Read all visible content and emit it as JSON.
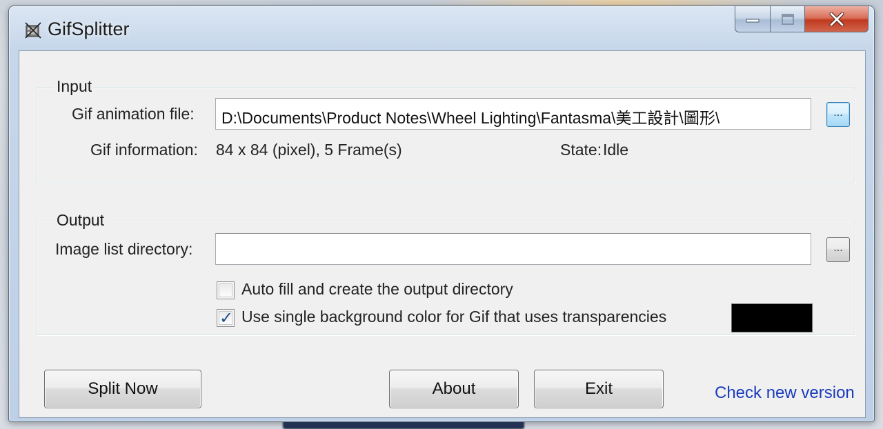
{
  "window": {
    "title": "GifSplitter"
  },
  "input": {
    "group_label": "Input",
    "file_label": "Gif animation file:",
    "file_value": "D:\\Documents\\Product Notes\\Wheel Lighting\\Fantasma\\美工設計\\圖形\\",
    "browse_label": "...",
    "info_label": "Gif information:",
    "info_value": "84 x 84 (pixel), 5 Frame(s)",
    "state_label": "State:",
    "state_value": "Idle"
  },
  "output": {
    "group_label": "Output",
    "dir_label": "Image list directory:",
    "dir_value": "",
    "browse_label": "...",
    "autofill_label": "Auto fill and create the output directory",
    "autofill_checked": false,
    "single_bg_label": "Use single background color for Gif that uses transparencies",
    "single_bg_checked": true,
    "bg_color": "#000000"
  },
  "buttons": {
    "split_now": "Split Now",
    "about": "About",
    "exit": "Exit",
    "check_version": "Check new version"
  }
}
